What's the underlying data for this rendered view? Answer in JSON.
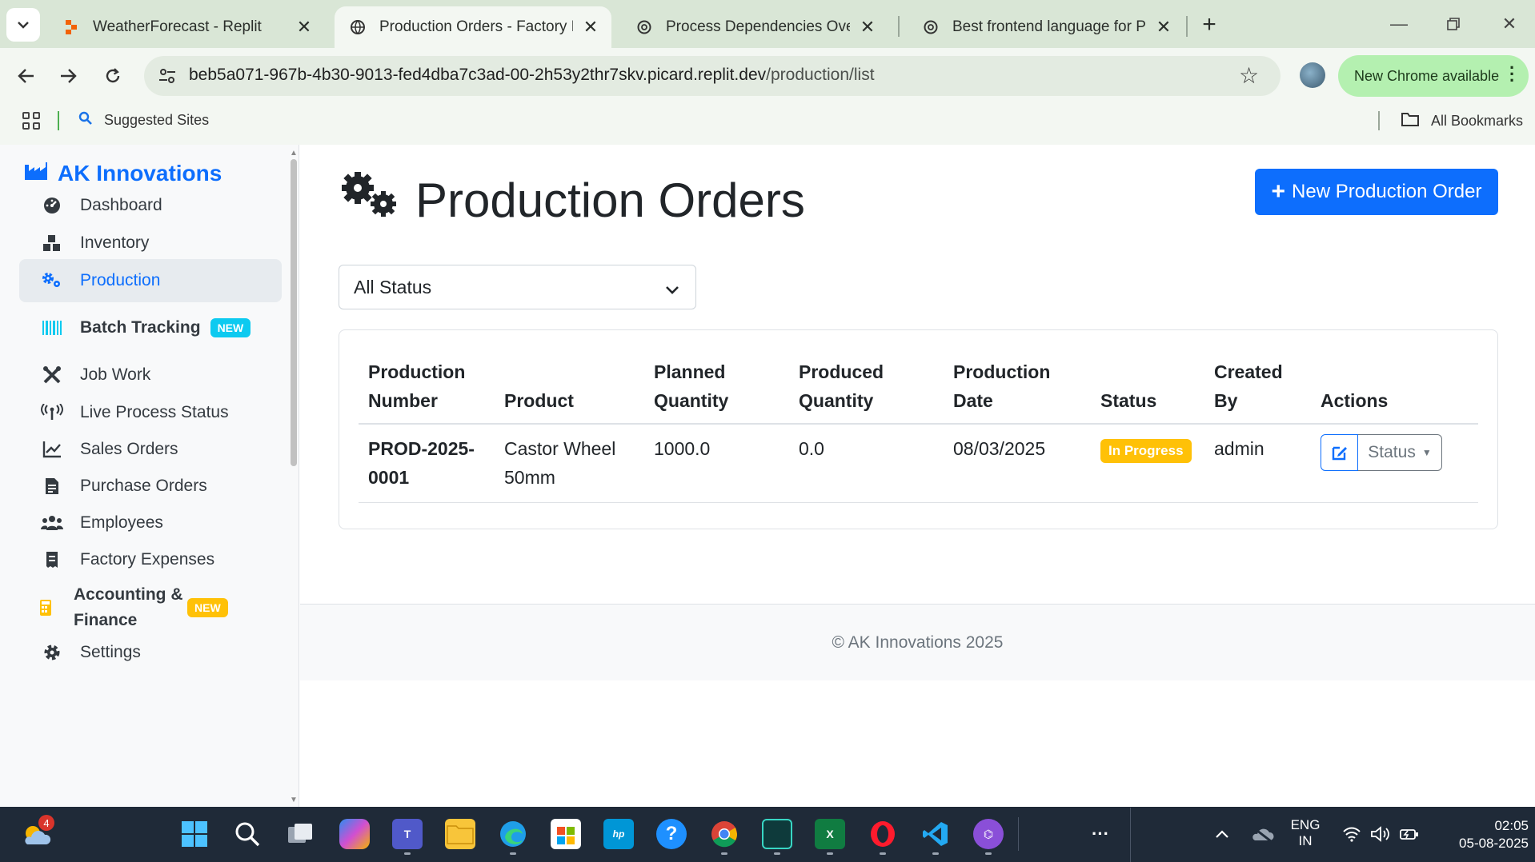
{
  "browser": {
    "tabs": [
      {
        "title": "WeatherForecast - Replit",
        "active": false
      },
      {
        "title": "Production Orders - Factory Ma",
        "active": true
      },
      {
        "title": "Process Dependencies Overview",
        "active": false
      },
      {
        "title": "Best frontend language for Pyth",
        "active": false
      }
    ],
    "url_host": "beb5a071-967b-4b30-9013-fed4dba7c3ad-00-2h53y2thr7skv.picard.replit.dev",
    "url_path": "/production/list",
    "update_label": "New Chrome available",
    "bookmarks": {
      "suggested": "Suggested Sites",
      "all": "All Bookmarks"
    }
  },
  "sidebar": {
    "brand": "AK Innovations",
    "items": [
      {
        "label": "Dashboard",
        "icon": "gauge-icon"
      },
      {
        "label": "Inventory",
        "icon": "boxes-icon"
      },
      {
        "label": "Production",
        "icon": "cogs-icon",
        "active": true
      },
      {
        "label": "Batch Tracking",
        "icon": "barcode-icon",
        "badge": "NEW"
      },
      {
        "label": "Job Work",
        "icon": "tools-icon"
      },
      {
        "label": "Live Process Status",
        "icon": "broadcast-icon"
      },
      {
        "label": "Sales Orders",
        "icon": "chart-line-icon"
      },
      {
        "label": "Purchase Orders",
        "icon": "file-invoice-icon"
      },
      {
        "label": "Employees",
        "icon": "users-icon"
      },
      {
        "label": "Factory Expenses",
        "icon": "receipt-icon"
      },
      {
        "label": "Accounting & Finance",
        "icon": "calculator-icon",
        "badge": "NEW"
      },
      {
        "label": "Settings",
        "icon": "gear-icon"
      }
    ]
  },
  "main": {
    "title": "Production Orders",
    "new_button": "New Production Order",
    "filter": {
      "selected": "All Status"
    },
    "table": {
      "headers": [
        "Production Number",
        "Product",
        "Planned Quantity",
        "Produced Quantity",
        "Production Date",
        "Status",
        "Created By",
        "Actions"
      ],
      "rows": [
        {
          "number": "PROD-2025-0001",
          "product": "Castor Wheel 50mm",
          "planned": "1000.0",
          "produced": "0.0",
          "date": "08/03/2025",
          "status": "In Progress",
          "created_by": "admin",
          "status_action": "Status"
        }
      ]
    },
    "footer": "© AK Innovations 2025"
  },
  "taskbar": {
    "weather_badge": "4",
    "lang_line1": "ENG",
    "lang_line2": "IN",
    "time": "02:05",
    "date": "05-08-2025"
  },
  "colors": {
    "primary": "#0d6efd",
    "warning": "#ffc107",
    "info": "#0dcaf0"
  }
}
